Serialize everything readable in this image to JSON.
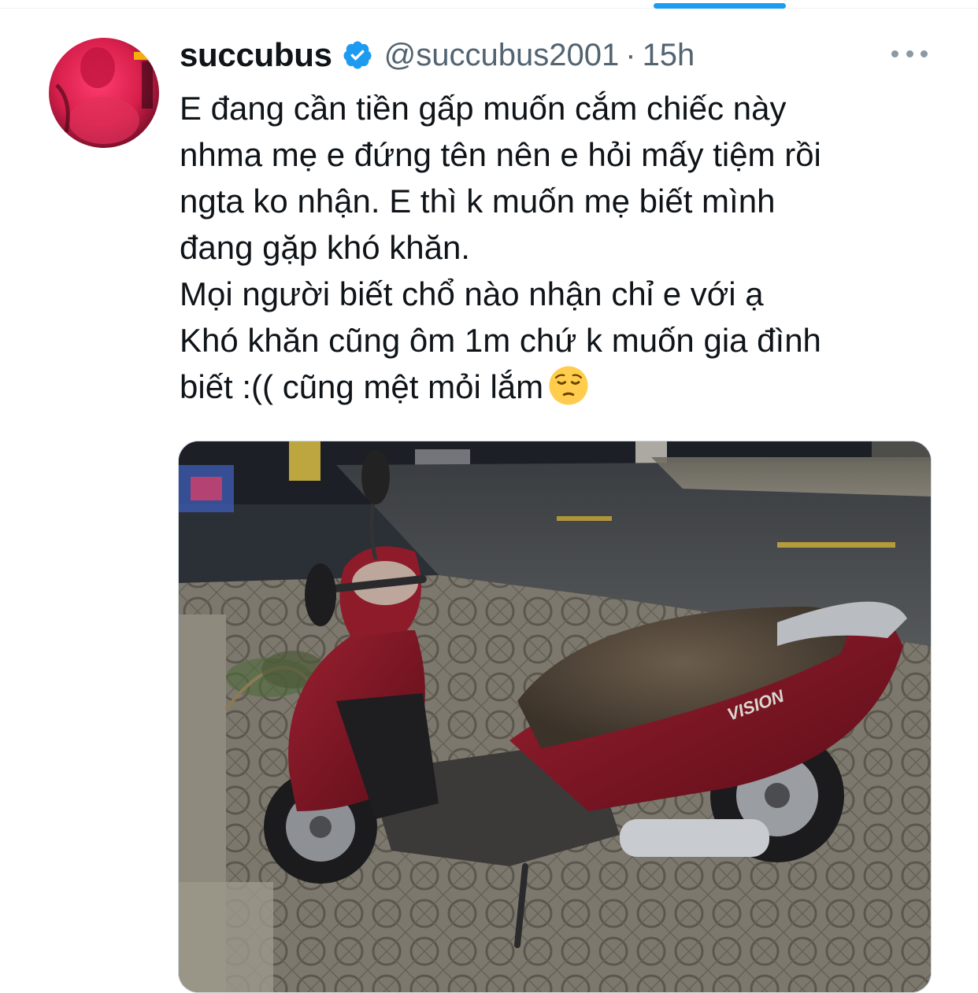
{
  "tweet": {
    "author": {
      "display_name": "succubus",
      "handle": "@succubus2001",
      "verified": true
    },
    "separator": "·",
    "time": "15h",
    "text_lines": [
      "E đang cần tiền gấp muốn cắm chiếc này",
      "nhma mẹ e đứng tên nên e hỏi mấy tiệm rồi",
      "ngta ko nhận. E thì k muốn mẹ biết mình",
      "đang gặp khó khăn.",
      "Mọi người biết chổ nào nhận chỉ e với ạ",
      "Khó khăn cũng ôm 1m chứ k muốn gia đình",
      "biết :(( cũng mệt mỏi lắm"
    ],
    "trailing_emoji": "pensive-face",
    "media": {
      "kind": "photo",
      "scooter_badge": "VISION"
    }
  },
  "colors": {
    "accent": "#1d9bf0",
    "secondary_text": "#536471",
    "scooter_body": "#7a1521"
  }
}
